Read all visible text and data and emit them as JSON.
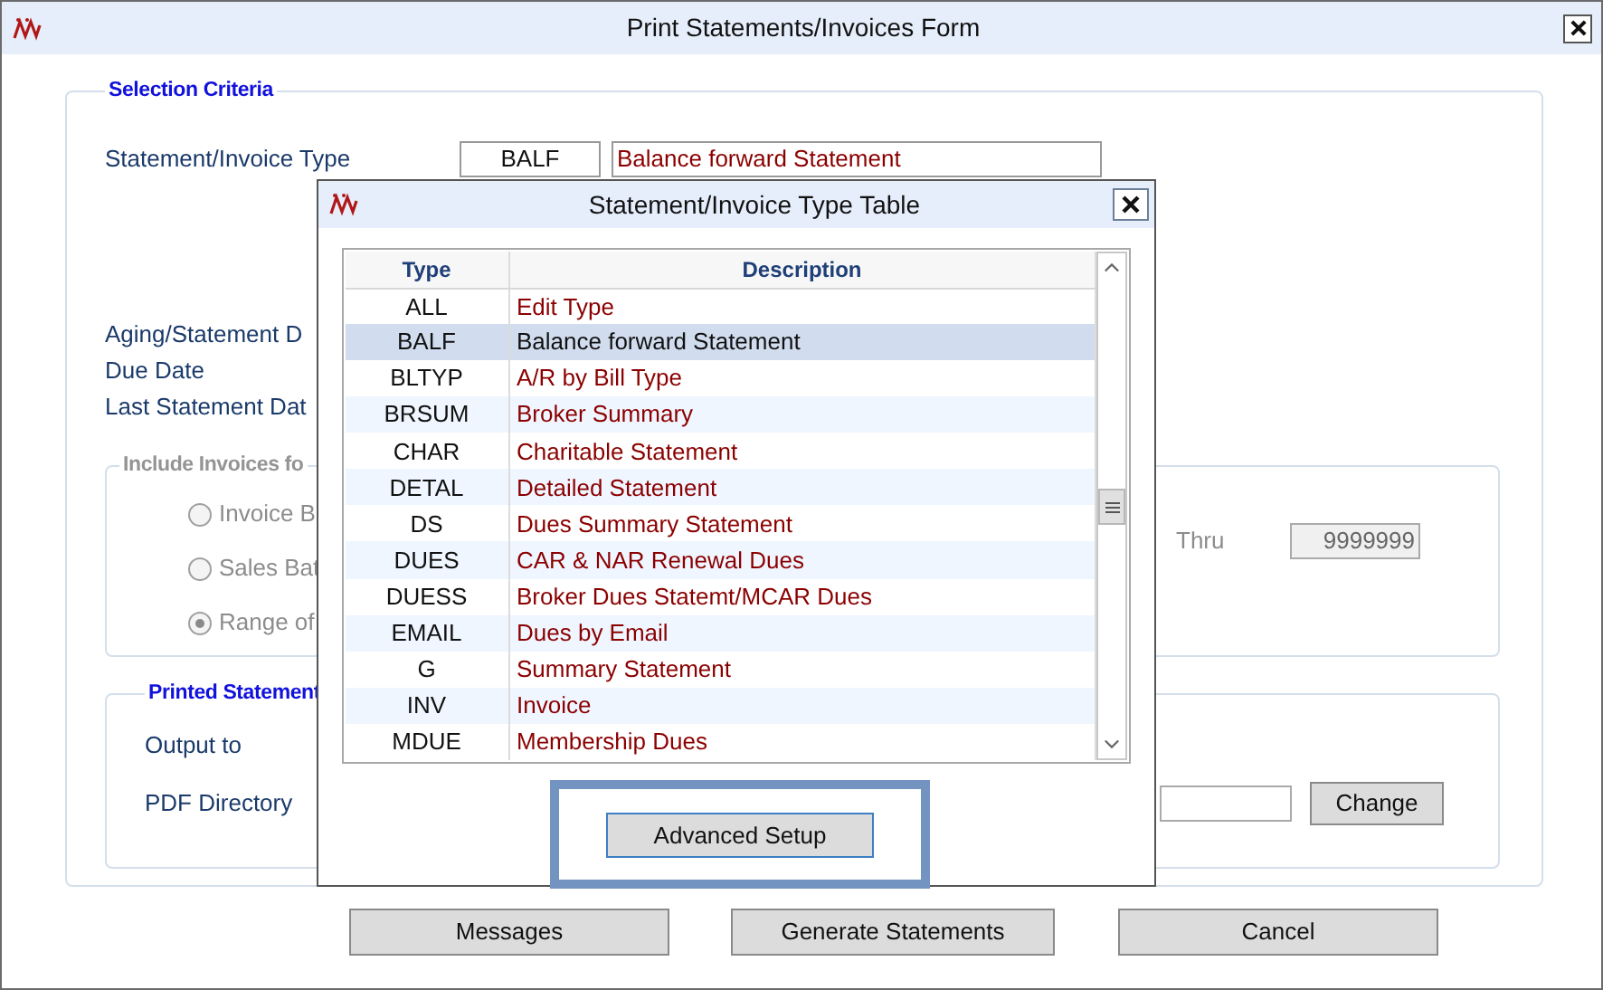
{
  "window": {
    "title": "Print Statements/Invoices Form"
  },
  "selection_criteria": {
    "legend": "Selection Criteria",
    "type_label": "Statement/Invoice Type",
    "type_code": "BALF",
    "type_description": "Balance forward Statement",
    "date_labels": [
      "Aging/Statement D",
      "Due Date",
      "Last Statement Dat"
    ]
  },
  "include_invoices": {
    "legend": "Include Invoices fo",
    "disabled": true,
    "options": [
      {
        "label": "Invoice B",
        "selected": false
      },
      {
        "label": "Sales Bat",
        "selected": false
      },
      {
        "label": "Range of",
        "selected": true
      }
    ],
    "thru_label": "Thru",
    "thru_value": "9999999"
  },
  "printed_statements": {
    "legend": "Printed Statement",
    "output_label": "Output to",
    "pdf_label": "PDF Directory",
    "change_button": "Change"
  },
  "buttons": [
    "Messages",
    "Generate Statements",
    "Cancel"
  ],
  "dialog": {
    "title": "Statement/Invoice Type Table",
    "columns": [
      "Type",
      "Description"
    ],
    "rows": [
      {
        "type": "ALL",
        "description": "Edit Type",
        "selected": false
      },
      {
        "type": "BALF",
        "description": "Balance forward Statement",
        "selected": true
      },
      {
        "type": "BLTYP",
        "description": "A/R by Bill Type",
        "selected": false
      },
      {
        "type": "BRSUM",
        "description": "Broker Summary",
        "selected": false
      },
      {
        "type": "CHAR",
        "description": "Charitable Statement",
        "selected": false
      },
      {
        "type": "DETAL",
        "description": "Detailed Statement",
        "selected": false
      },
      {
        "type": "DS",
        "description": "Dues Summary Statement",
        "selected": false
      },
      {
        "type": "DUES",
        "description": "CAR & NAR Renewal Dues",
        "selected": false
      },
      {
        "type": "DUESS",
        "description": "Broker Dues Statemt/MCAR Dues",
        "selected": false
      },
      {
        "type": "EMAIL",
        "description": "Dues by Email",
        "selected": false
      },
      {
        "type": "G",
        "description": "Summary Statement",
        "selected": false
      },
      {
        "type": "INV",
        "description": "Invoice",
        "selected": false
      },
      {
        "type": "MDUE",
        "description": "Membership Dues",
        "selected": false
      }
    ],
    "button": "Advanced Setup"
  }
}
